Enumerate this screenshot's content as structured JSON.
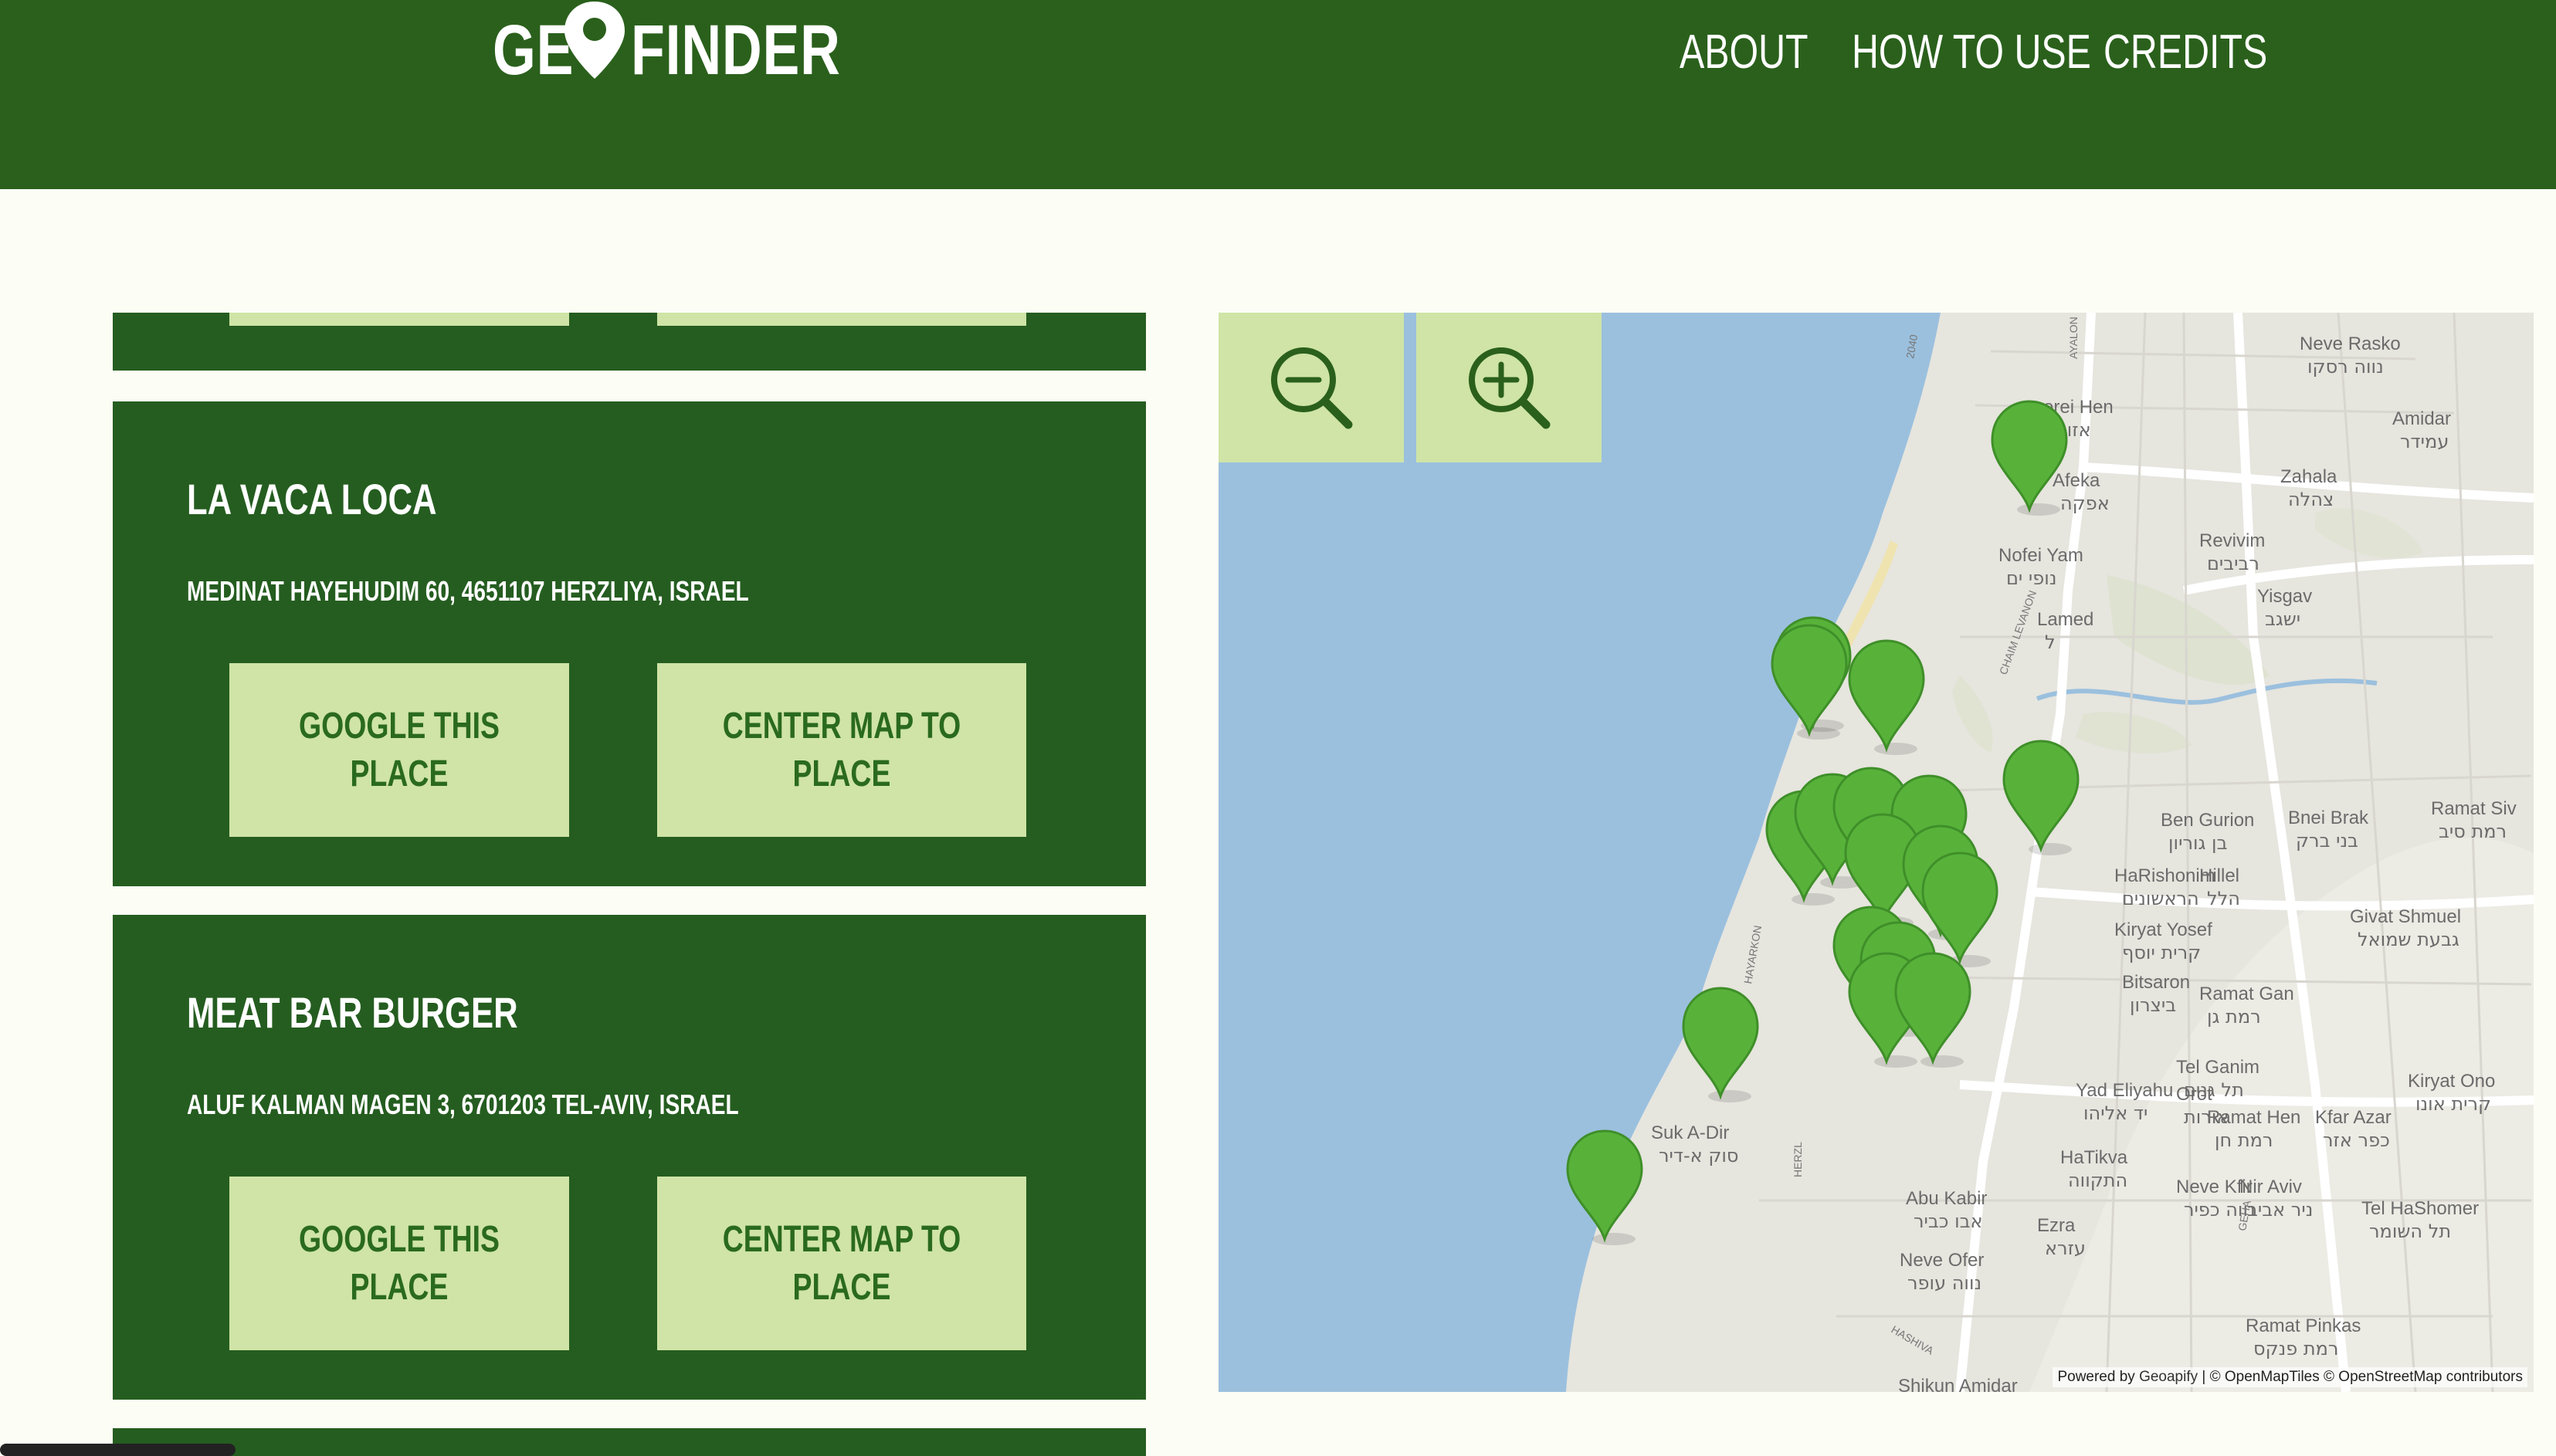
{
  "header": {
    "logo_left": "GE",
    "logo_right": "FINDER",
    "nav": [
      "ABOUT",
      "HOW TO USE",
      "CREDITS"
    ]
  },
  "places": [
    {
      "name": "LA VACA LOCA",
      "address": "MEDINAT HAYEHUDIM 60, 4651107 HERZLIYA, ISRAEL",
      "google_label": "GOOGLE THIS PLACE",
      "center_label": "CENTER MAP TO PLACE"
    },
    {
      "name": "MEAT BAR BURGER",
      "address": "ALUF KALMAN MAGEN 3, 6701203 TEL-AVIV, ISRAEL",
      "google_label": "GOOGLE THIS PLACE",
      "center_label": "CENTER MAP TO PLACE"
    }
  ],
  "buttons": {
    "google_line1": "GOOGLE THIS",
    "google_line2": "PLACE",
    "center_line1": "CENTER MAP TO",
    "center_line2": "PLACE"
  },
  "map": {
    "zoom_out_icon": "zoom-out-icon",
    "zoom_in_icon": "zoom-in-icon",
    "marker_color": "#58b23a",
    "attribution_prefix": "Powered by",
    "attribution_geoapify": "Geoapify",
    "attribution_rest": "| © OpenMapTiles © OpenStreetMap contributors",
    "labels": [
      {
        "en": "Neve Rasko",
        "he": "נווה רסקו"
      },
      {
        "en": "Amidar",
        "he": "עמידר"
      },
      {
        "en": "Azorei Hen",
        "he": "אזורי חן"
      },
      {
        "en": "Afeka",
        "he": "אפקה"
      },
      {
        "en": "Zahala",
        "he": "צהלה"
      },
      {
        "en": "Revivim",
        "he": "רביבים"
      },
      {
        "en": "Yisgav",
        "he": "ישגב"
      },
      {
        "en": "Nofei Yam",
        "he": "נופי ים"
      },
      {
        "en": "Lamed",
        "he": "ל"
      },
      {
        "en": "Ben Gurion",
        "he": "בן גוריון"
      },
      {
        "en": "Bnei Brak",
        "he": "בני ברק"
      },
      {
        "en": "Ramat Siv",
        "he": "רמת סיב"
      },
      {
        "en": "HaRishonim",
        "he": "הראשונים"
      },
      {
        "en": "Hillel",
        "he": "הלל"
      },
      {
        "en": "Kiryat Yosef",
        "he": "קרית יוסף"
      },
      {
        "en": "Givat Shmuel",
        "he": "גבעת שמואל"
      },
      {
        "en": "Bitsaron",
        "he": "ביצרון"
      },
      {
        "en": "Ramat Gan",
        "he": "רמת גן"
      },
      {
        "en": "Tel Ganim",
        "he": "תל גנים"
      },
      {
        "en": "Kiryat Ono",
        "he": "קרית אונו"
      },
      {
        "en": "Yad Eliyahu",
        "he": "יד אליהו"
      },
      {
        "en": "Orot",
        "he": "אורות"
      },
      {
        "en": "Ramat Hen",
        "he": "רמת חן"
      },
      {
        "en": "Kfar Azar",
        "he": "כפר אזר"
      },
      {
        "en": "Suk A-Dir",
        "he": "סוק א-דיר"
      },
      {
        "en": "HaTikva",
        "he": "התקווה"
      },
      {
        "en": "Neve Kfir",
        "he": "נווה כפיר"
      },
      {
        "en": "Nir Aviv",
        "he": "ניר אביב"
      },
      {
        "en": "Abu Kabir",
        "he": "אבו כביר"
      },
      {
        "en": "Ezra",
        "he": "עזרא"
      },
      {
        "en": "Tel HaShomer",
        "he": "תל השומר"
      },
      {
        "en": "Neve Ofer",
        "he": "נווה עופר"
      },
      {
        "en": "Ramat Pinkas",
        "he": "רמת פנקס"
      },
      {
        "en": "Shikun Amidar",
        "he": ""
      }
    ],
    "road_labels": [
      "AYALON",
      "2040",
      "CHAIM LEVANON",
      "HAYARKON",
      "HERZL",
      "GEHA",
      "HASHIVA"
    ]
  }
}
